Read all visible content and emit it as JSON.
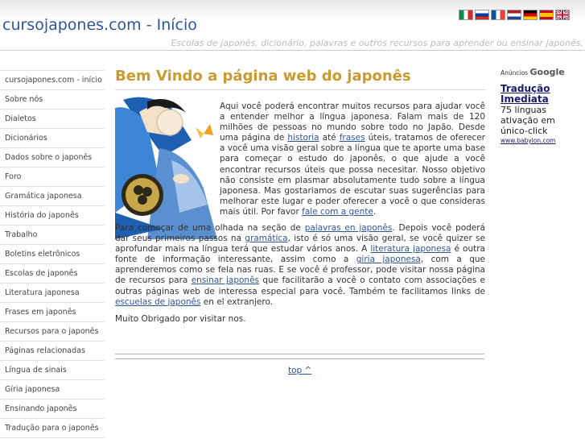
{
  "header": {
    "site_title": "cursojapones.com - Início",
    "tagline": "Escolas de japonês, dicionário, palavras e outros recursos para aprender ou ensinar japonês."
  },
  "flags": [
    "Italiano",
    "Русский",
    "Français",
    "Nederlands",
    "Deutsch",
    "Español",
    "English"
  ],
  "sidebar": {
    "items": [
      "cursojapones.com - início",
      "Sobre nós",
      "Dialetos",
      "Dicionários",
      "Dados sobre o japonês",
      "Foro",
      "Gramática japonesa",
      "História do japonês",
      "Trabalho",
      "Boletins eletrônicos",
      "Escolas de japonês",
      "Literatura japonesa",
      "Frases em japonês",
      "Recursos para o japonês",
      "Páginas relacionadas",
      "Língua de sinais",
      "Gíria japonesa",
      "Ensinando japonês",
      "Tradução para o japonês"
    ]
  },
  "main": {
    "title": "Bem Vindo a página web do japonês",
    "p1_a": "Aqui você poderá encontrar muitos recursos para ajudar você a entender melhor a língua japonesa. Falam mais de 120 milhões de pessoas no mundo sobre todo no Japão. Desde uma página de ",
    "p1_link1": "historia",
    "p1_b": " até ",
    "p1_link2": "frases",
    "p1_c": " úteis, tratamos de oferecer a você uma visão geral sobre a língua que te aporte uma base para começar o estudo do japonês, o que ajude a você encontrar recursos úteis que possa necesitar. Nosso objetivo não consiste em plasmar absolutamente tudo sobre a língua japonesa. Mas gostariamos de escutar suas sugerências para melhorar este lugar e poder oferecer a você o que consideras mais útil. Por favor ",
    "p1_link3": "fale com a gente",
    "p1_d": ".",
    "p2_a": "Para começar de uma olhada na seção de ",
    "p2_link1": "palavras en japonês",
    "p2_b": ". Depois você poderá dar seus primeiros passos na ",
    "p2_link2": "gramática",
    "p2_c": ", isto é só uma visão geral, se você quizer se aprofundar mais na língua terá que estudar vários anos. A ",
    "p2_link3": "literatura japonesa",
    "p2_d": " é outra fonte de informação interessante, assim como a ",
    "p2_link4": "giria japonesa",
    "p2_e": ", com a que aprenderemos como se fela nas ruas. E se você é professor, pode visitar nossa página de recursos para ",
    "p2_link5": "ensinar japonês",
    "p2_f": " que facilitarão a você o contato com associações e outras páginas web de interessa especial para você. Também te facilitamos links de ",
    "p2_link6": "escuelas de japonês",
    "p2_g": " en el extranjero.",
    "p3": "Muito Obrigado por visitar nos.",
    "top_link": "top ^"
  },
  "ad": {
    "header_label": "Anúncios",
    "header_brand": "Google",
    "title": "Tradução Imediata",
    "body": "75 línguas ativação em único-click",
    "url": "www.babylon.com"
  },
  "colors": {
    "title_blue": "#2f5597",
    "heading_gold": "#c99a2e",
    "ad_blue": "#1a1a6e"
  }
}
